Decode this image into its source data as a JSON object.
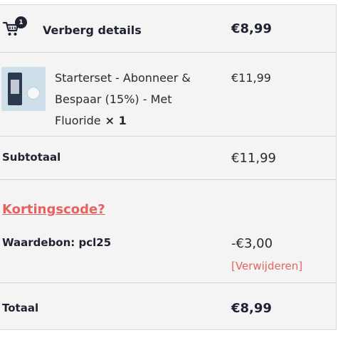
{
  "summary": {
    "cart_count": "1",
    "toggle_label": "Verberg details",
    "total": "€8,99"
  },
  "product": {
    "title": "Starterset - Abonneer & Bespaar (15%) - Met Fluoride",
    "quantity": "× 1",
    "price": "€11,99"
  },
  "subtotal": {
    "label": "Subtotaal",
    "value": "€11,99"
  },
  "discount": {
    "coupon_link": "Kortingscode?",
    "voucher_label": "Waardebon: pcl25",
    "voucher_value": "-€3,00",
    "remove_label": "[Verwijderen]"
  },
  "total": {
    "label": "Totaal",
    "value": "€8,99"
  },
  "colors": {
    "accent": "#e5635e",
    "dark": "#1f2230",
    "panel_bg": "#f4f4f4"
  }
}
